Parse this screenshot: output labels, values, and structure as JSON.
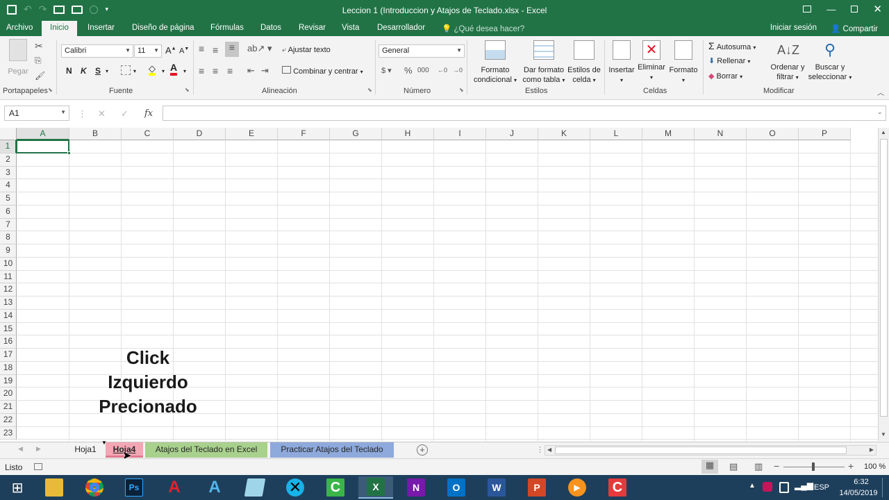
{
  "window": {
    "title": "Leccion 1 (Introduccion y Atajos de Teclado.xlsx - Excel"
  },
  "menu": {
    "tabs": [
      "Archivo",
      "Inicio",
      "Insertar",
      "Diseño de página",
      "Fórmulas",
      "Datos",
      "Revisar",
      "Vista",
      "Desarrollador"
    ],
    "active_tab": "Inicio",
    "tell_me": "¿Qué desea hacer?",
    "signin": "Iniciar sesión",
    "share": "Compartir"
  },
  "ribbon": {
    "clipboard": {
      "paste": "Pegar",
      "label": "Portapapeles"
    },
    "font": {
      "name": "Calibri",
      "size": "11",
      "bold": "N",
      "italic": "K",
      "underline": "S",
      "label": "Fuente"
    },
    "alignment": {
      "wrap": "Ajustar texto",
      "merge": "Combinar y centrar",
      "label": "Alineación"
    },
    "number": {
      "format": "General",
      "label": "Número"
    },
    "styles": {
      "conditional": [
        "Formato",
        "condicional"
      ],
      "as_table": [
        "Dar formato",
        "como tabla"
      ],
      "cell_styles": [
        "Estilos de",
        "celda"
      ],
      "label": "Estilos"
    },
    "cells": {
      "insert": "Insertar",
      "delete": "Eliminar",
      "format": "Formato",
      "label": "Celdas"
    },
    "editing": {
      "autosum": "Autosuma",
      "fill": "Rellenar",
      "clear": "Borrar",
      "sort": [
        "Ordenar y",
        "filtrar"
      ],
      "find": [
        "Buscar y",
        "seleccionar"
      ],
      "label": "Modificar"
    }
  },
  "formula_bar": {
    "name_box": "A1",
    "fx": "fx",
    "value": ""
  },
  "grid": {
    "columns": [
      "A",
      "B",
      "C",
      "D",
      "E",
      "F",
      "G",
      "H",
      "I",
      "J",
      "K",
      "L",
      "M",
      "N",
      "O",
      "P"
    ],
    "rows": [
      "1",
      "2",
      "3",
      "4",
      "5",
      "6",
      "7",
      "8",
      "9",
      "10",
      "11",
      "12",
      "13",
      "14",
      "15",
      "16",
      "17",
      "18",
      "19",
      "20",
      "21",
      "22",
      "23"
    ],
    "selected_cell": "A1"
  },
  "sheets": [
    {
      "name": "Hoja1",
      "color": "",
      "state": "normal"
    },
    {
      "name": "Hoja4",
      "color": "#f4a6b4",
      "state": "dragging"
    },
    {
      "name": "Atajos del Teclado en Excel",
      "color": "#a9d18e",
      "state": "normal"
    },
    {
      "name": "Practicar Atajos del Teclado",
      "color": "#8ea9db",
      "state": "normal"
    }
  ],
  "overlay_text": [
    "Click",
    "Izquierdo",
    "Precionado"
  ],
  "status": {
    "ready": "Listo",
    "zoom": "100 %"
  },
  "taskbar": {
    "apps": [
      "windows-start",
      "file-explorer",
      "chrome",
      "photoshop",
      "acrobat",
      "autocad",
      "notepad",
      "kodi",
      "camtasia",
      "excel",
      "onenote",
      "outlook",
      "word",
      "powerpoint",
      "media-player",
      "camtasia-recorder"
    ],
    "language": "ESP",
    "time": "6:32",
    "date": "14/05/2019"
  },
  "colors": {
    "excel_green": "#217346",
    "ribbon_bg": "#f3f3f3",
    "taskbar": "#1e3f5c"
  }
}
